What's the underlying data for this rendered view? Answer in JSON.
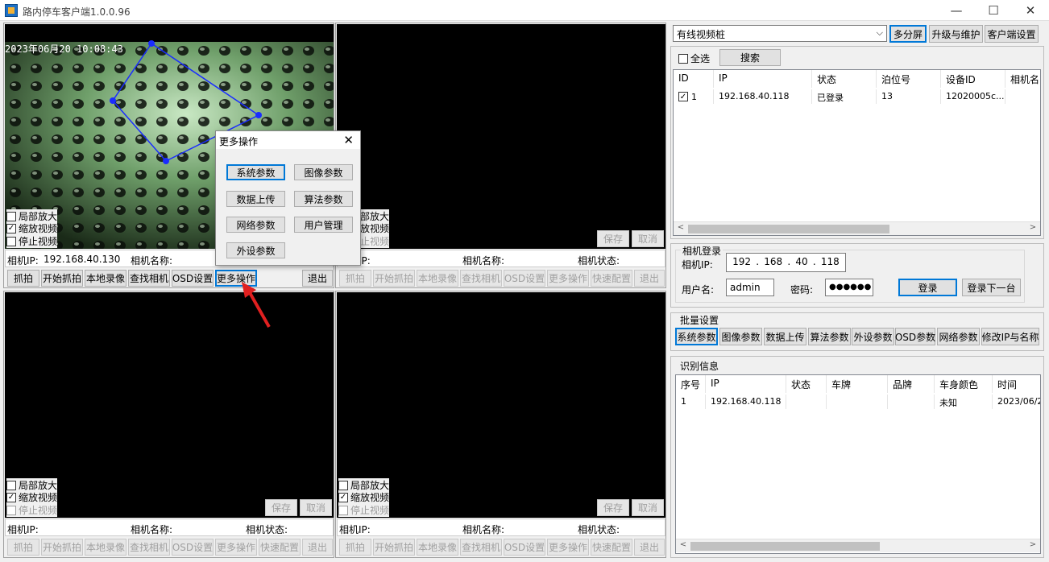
{
  "app": {
    "title": "路内停车客户端1.0.0.96"
  },
  "window": {
    "minimize": "—",
    "maximize": "☐",
    "close": "✕"
  },
  "video": {
    "timestamp": "2023年06月20  10:08:43"
  },
  "pane_labels": {
    "camera_ip": "相机IP:",
    "camera_name": "相机名称:",
    "camera_status": "相机状态:"
  },
  "pane1": {
    "ip": "192.168.40.130"
  },
  "checks": {
    "zoom": "局部放大",
    "scale": "缩放视频",
    "stop": "停止视频"
  },
  "save_cancel": {
    "save": "保存",
    "cancel": "取消"
  },
  "pane_buttons": {
    "capture": "抓拍",
    "start_capture": "开始抓拍",
    "local_record": "本地录像",
    "find_camera": "查找相机",
    "osd": "OSD设置",
    "more_ops": "更多操作",
    "quick_config": "快速配置",
    "exit": "退出"
  },
  "dialog": {
    "title": "更多操作",
    "close": "✕",
    "buttons": {
      "system_params": "系统参数",
      "image_params": "图像参数",
      "data_upload": "数据上传",
      "algo_params": "算法参数",
      "network_params": "网络参数",
      "user_mgmt": "用户管理",
      "peripheral_params": "外设参数"
    }
  },
  "right": {
    "device_select": "有线视频桩",
    "multiscreen": "多分屏",
    "upgrade": "升级与维护",
    "client_settings": "客户端设置",
    "select_all": "全选",
    "search": "搜索",
    "device_table": {
      "headers": [
        "ID",
        "IP",
        "状态",
        "泊位号",
        "设备ID",
        "相机名"
      ],
      "rows": [
        [
          "1",
          "192.168.40.118",
          "已登录",
          "13",
          "12020005c..."
        ]
      ]
    },
    "login": {
      "group": "相机登录",
      "ip_label": "相机IP:",
      "ip": [
        "192",
        "168",
        "40",
        "118"
      ],
      "user_label": "用户名:",
      "user": "admin",
      "pwd_label": "密码:",
      "pwd": "●●●●●●",
      "login": "登录",
      "login_next": "登录下一台"
    },
    "batch": {
      "group": "批量设置",
      "buttons": [
        "系统参数",
        "图像参数",
        "数据上传",
        "算法参数",
        "外设参数",
        "OSD参数",
        "网络参数",
        "修改IP与名称"
      ]
    },
    "recog": {
      "group": "识别信息",
      "headers": [
        "序号",
        "IP",
        "状态",
        "车牌",
        "品牌",
        "车身颜色",
        "时间"
      ],
      "rows": [
        [
          "1",
          "192.168.40.118",
          "",
          "",
          "",
          "未知",
          "2023/06/2"
        ]
      ]
    }
  },
  "colors": {
    "accent": "#0078d7",
    "annotation": "#e02020"
  }
}
